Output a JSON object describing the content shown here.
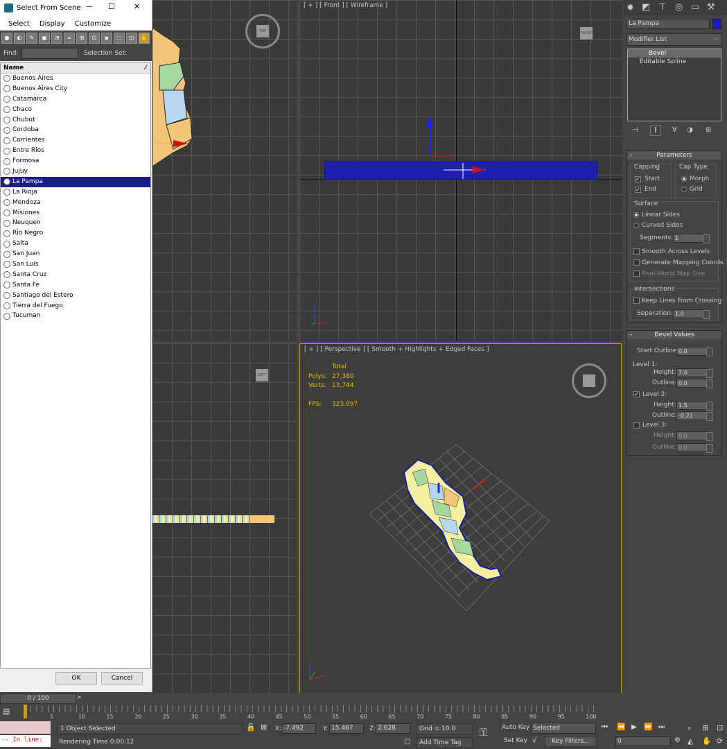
{
  "dialog": {
    "title": "Select From Scene",
    "menu": [
      "Select",
      "Display",
      "Customize"
    ],
    "find_label": "Find:",
    "selection_set_label": "Selection Set:",
    "column_header": "Name",
    "items": [
      "Buenos Aires",
      "Buenos Aires City",
      "Catamarca",
      "Chaco",
      "Chubut",
      "Cordoba",
      "Corrientes",
      "Entre Rios",
      "Formosa",
      "Jujuy",
      "La Pampa",
      "La Rioja",
      "Mendoza",
      "Misiones",
      "Neuquen",
      "Rio Negro",
      "Salta",
      "San Juan",
      "San Luis",
      "Santa Cruz",
      "Santa Fe",
      "Santiago del Estero",
      "Tierra del Fuego",
      "Tucuman"
    ],
    "selected": "La Pampa",
    "ok": "OK",
    "cancel": "Cancel",
    "window_controls": {
      "minimize": "—",
      "maximize": "☐",
      "close": "✕"
    }
  },
  "viewports": {
    "front_label": "[ + ] [ Front ] [ Wireframe ]",
    "persp_label": "[ + ] [ Perspective ] [ Smooth + Highlights + Edged Faces ]",
    "stats": {
      "total": "Total",
      "polys_label": "Polys:",
      "polys": "27,380",
      "verts_label": "Verts:",
      "verts": "13,744",
      "fps_label": "FPS:",
      "fps": "323.097"
    },
    "cube_top": "TOP",
    "cube_front": "FRONT",
    "cube_left": "LEFT"
  },
  "panel": {
    "object_name": "La Pampa",
    "modifier_list": "Modifier List",
    "stack": [
      "Bevel",
      "Editable Spline"
    ],
    "parameters": {
      "title": "Parameters",
      "capping": "Capping",
      "start": "Start",
      "end": "End",
      "cap_type": "Cap Type",
      "morph": "Morph",
      "grid": "Grid",
      "surface": "Surface",
      "linear": "Linear Sides",
      "curved": "Curved Sides",
      "segments_label": "Segments:",
      "segments": "1",
      "smooth": "Smooth Across Levels",
      "gen_map": "Generate Mapping Coords.",
      "real_world": "Real-World Map Size",
      "intersections": "Intersections",
      "keep_lines": "Keep Lines From Crossing",
      "separation_label": "Separation:",
      "separation": "1.0"
    },
    "bevel": {
      "title": "Bevel Values",
      "start_outline_label": "Start Outline:",
      "start_outline": "0.0",
      "level1": "Level 1:",
      "height_label": "Height:",
      "outline_label": "Outline:",
      "l1_height": "7.0",
      "l1_outline": "0.0",
      "level2": "Level 2:",
      "l2_height": "1.5",
      "l2_outline": "-0.21",
      "level3": "Level 3:",
      "l3_height": "0.0",
      "l3_outline": "0.0"
    }
  },
  "bottom": {
    "frame": "0 / 100",
    "ticks": [
      "5",
      "10",
      "15",
      "20",
      "25",
      "30",
      "35",
      "40",
      "45",
      "50",
      "55",
      "60",
      "65",
      "70",
      "75",
      "80",
      "85",
      "90",
      "95",
      "100"
    ],
    "maxscript": "-- In line:",
    "status": "1 Object Selected",
    "rendering": "Rendering Time  0:00:12",
    "x_label": "X:",
    "x": "-7.492",
    "y_label": "Y:",
    "y": "15.467",
    "z_label": "Z:",
    "z": "2.628",
    "grid": "Grid = 10.0",
    "add_time_tag": "Add Time Tag",
    "auto_key": "Auto Key",
    "set_key": "Set Key",
    "selected": "Selected",
    "key_filters": "Key Filters...",
    "frame_field": "0"
  }
}
